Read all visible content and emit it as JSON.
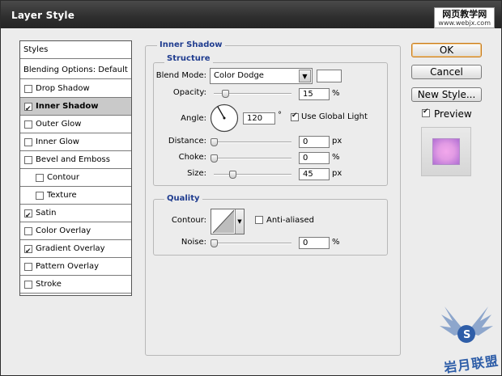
{
  "window": {
    "title": "Layer Style"
  },
  "watermark_top": {
    "line1": "网页教学网",
    "line2": "www.webjx.com"
  },
  "watermark_bottom": {
    "text": "岩月联盟"
  },
  "style_list": [
    {
      "label": "Styles",
      "checkbox": false,
      "checked": false,
      "selected": false,
      "indent": 0
    },
    {
      "label": "Blending Options: Default",
      "checkbox": false,
      "checked": false,
      "selected": false,
      "indent": 0
    },
    {
      "label": "Drop Shadow",
      "checkbox": true,
      "checked": false,
      "selected": false,
      "indent": 0
    },
    {
      "label": "Inner Shadow",
      "checkbox": true,
      "checked": true,
      "selected": true,
      "indent": 0
    },
    {
      "label": "Outer Glow",
      "checkbox": true,
      "checked": false,
      "selected": false,
      "indent": 0
    },
    {
      "label": "Inner Glow",
      "checkbox": true,
      "checked": false,
      "selected": false,
      "indent": 0
    },
    {
      "label": "Bevel and Emboss",
      "checkbox": true,
      "checked": false,
      "selected": false,
      "indent": 0
    },
    {
      "label": "Contour",
      "checkbox": true,
      "checked": false,
      "selected": false,
      "indent": 1
    },
    {
      "label": "Texture",
      "checkbox": true,
      "checked": false,
      "selected": false,
      "indent": 1
    },
    {
      "label": "Satin",
      "checkbox": true,
      "checked": true,
      "selected": false,
      "indent": 0
    },
    {
      "label": "Color Overlay",
      "checkbox": true,
      "checked": false,
      "selected": false,
      "indent": 0
    },
    {
      "label": "Gradient Overlay",
      "checkbox": true,
      "checked": true,
      "selected": false,
      "indent": 0
    },
    {
      "label": "Pattern Overlay",
      "checkbox": true,
      "checked": false,
      "selected": false,
      "indent": 0
    },
    {
      "label": "Stroke",
      "checkbox": true,
      "checked": false,
      "selected": false,
      "indent": 0
    }
  ],
  "inner_shadow": {
    "group_title": "Inner Shadow",
    "structure_title": "Structure",
    "blend_mode_label": "Blend Mode:",
    "blend_mode_value": "Color Dodge",
    "shadow_color": "#ffffff",
    "opacity_label": "Opacity:",
    "opacity_value": "15",
    "opacity_unit": "%",
    "angle_label": "Angle:",
    "angle_value": "120",
    "angle_unit": "°",
    "angle_degrees": 120,
    "global_light_label": "Use Global Light",
    "global_light_checked": true,
    "distance_label": "Distance:",
    "distance_value": "0",
    "distance_unit": "px",
    "choke_label": "Choke:",
    "choke_value": "0",
    "choke_unit": "%",
    "size_label": "Size:",
    "size_value": "45",
    "size_unit": "px",
    "quality_title": "Quality",
    "contour_label": "Contour:",
    "anti_aliased_label": "Anti-aliased",
    "anti_aliased_checked": false,
    "noise_label": "Noise:",
    "noise_value": "0",
    "noise_unit": "%"
  },
  "buttons": {
    "ok": "OK",
    "cancel": "Cancel",
    "new_style": "New Style..."
  },
  "preview": {
    "label": "Preview",
    "checked": true
  },
  "colors": {
    "accent": "#1f3c8f",
    "titlebar": "#2e2e2e",
    "selected_row": "#c9c9c9",
    "preview_fill": "#e29be4"
  }
}
